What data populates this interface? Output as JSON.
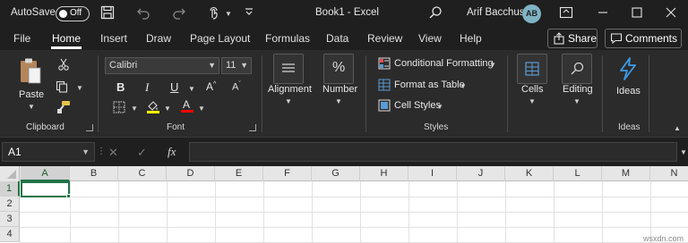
{
  "titlebar": {
    "autosave_label": "AutoSave",
    "autosave_state": "Off",
    "title": "Book1  -  Excel",
    "user_name": "Arif Bacchus",
    "user_initials": "AB"
  },
  "menu": {
    "tabs": [
      "File",
      "Home",
      "Insert",
      "Draw",
      "Page Layout",
      "Formulas",
      "Data",
      "Review",
      "View",
      "Help"
    ],
    "active_tab": "Home",
    "share_label": "Share",
    "comments_label": "Comments"
  },
  "ribbon": {
    "clipboard": {
      "paste_label": "Paste",
      "group_label": "Clipboard"
    },
    "font": {
      "font_name": "Calibri",
      "font_size": "11",
      "group_label": "Font",
      "highlight_color": "#ffff00",
      "font_color": "#ff0000"
    },
    "alignment": {
      "label": "Alignment"
    },
    "number": {
      "label": "Number",
      "icon_text": "%"
    },
    "styles": {
      "conditional_formatting": "Conditional Formatting",
      "format_as_table": "Format as Table",
      "cell_styles": "Cell Styles",
      "group_label": "Styles"
    },
    "cells": {
      "label": "Cells"
    },
    "editing": {
      "label": "Editing"
    },
    "ideas": {
      "button_label": "Ideas",
      "group_label": "Ideas"
    }
  },
  "formula_bar": {
    "name_box": "A1",
    "fx_label": "fx",
    "formula": ""
  },
  "grid": {
    "columns": [
      "A",
      "B",
      "C",
      "D",
      "E",
      "F",
      "G",
      "H",
      "I",
      "J",
      "K",
      "L",
      "M",
      "N"
    ],
    "rows": [
      "1",
      "2",
      "3",
      "4"
    ],
    "active_cell": "A1"
  },
  "watermark": "wsxdn.com",
  "colors": {
    "accent_green": "#217346",
    "titlebar_bg": "#1f1f1f",
    "ribbon_bg": "#2b2b2b",
    "ideas_blue": "#3d9be9"
  }
}
